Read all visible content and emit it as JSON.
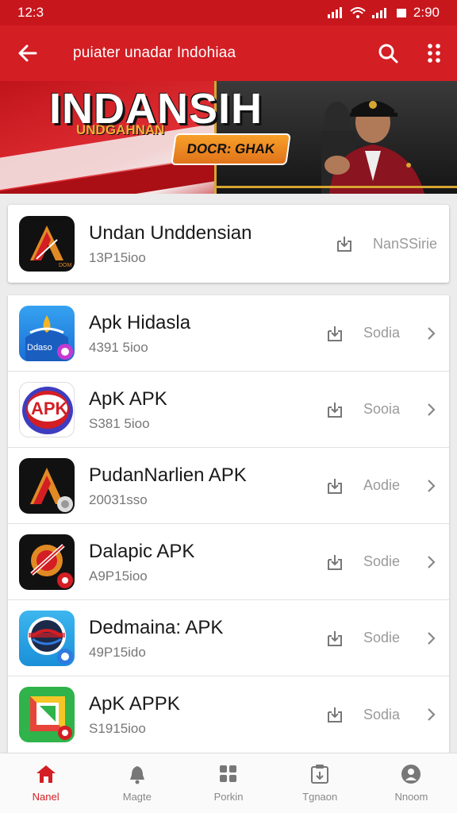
{
  "status_bar": {
    "time": "12:3",
    "clock_right": "2:90"
  },
  "app_bar": {
    "title": "puiater unadar Indohiaa"
  },
  "banner": {
    "title": "INDANSIH",
    "subtitle": "UNDGAHNAN",
    "cta": "DOCR: GHAK"
  },
  "featured": {
    "name": "Undan Unddensian",
    "size": "13P15ioo",
    "action_label": "NanSSirie"
  },
  "apps": [
    {
      "name": "Apk Hidasla",
      "size": "4391 5ioo",
      "action_label": "Sodia"
    },
    {
      "name": "ApK APK",
      "size": "S381 5ioo",
      "action_label": "Sooia"
    },
    {
      "name": "PudanNarlien APK",
      "size": "20031sso",
      "action_label": "Aodie"
    },
    {
      "name": "Dalapic APK",
      "size": "A9P15ioo",
      "action_label": "Sodie"
    },
    {
      "name": "Dedmaina: APK",
      "size": "49P15ido",
      "action_label": "Sodie"
    },
    {
      "name": "ApK APPK",
      "size": "S1915ioo",
      "action_label": "Sodia"
    }
  ],
  "bottom_nav": [
    {
      "label": "Nanel",
      "icon": "home-icon",
      "active": true
    },
    {
      "label": "Magte",
      "icon": "bell-icon",
      "active": false
    },
    {
      "label": "Porkin",
      "icon": "grid-icon",
      "active": false
    },
    {
      "label": "Tgnaon",
      "icon": "clipboard-icon",
      "active": false
    },
    {
      "label": "Nnoom",
      "icon": "profile-icon",
      "active": false
    }
  ],
  "colors": {
    "primary": "#d31e24",
    "status_bar": "#c8161d",
    "active_nav": "#d31e24"
  }
}
